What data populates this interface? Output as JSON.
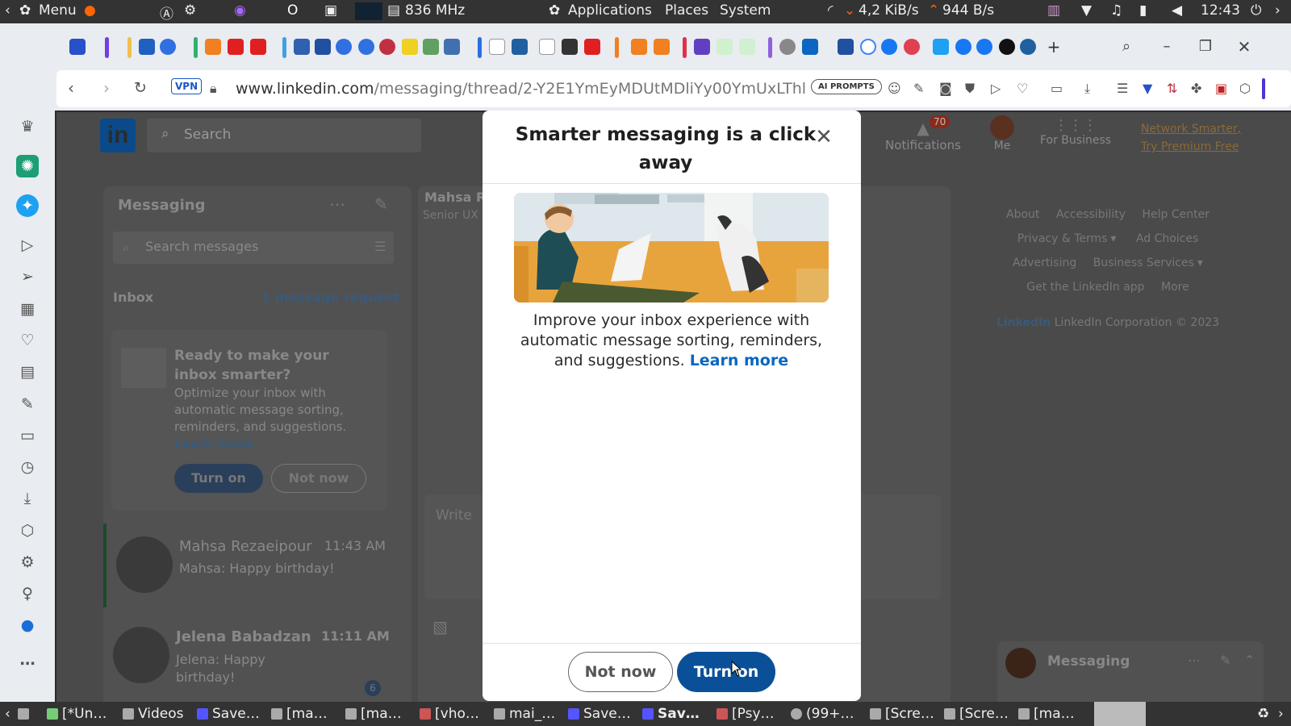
{
  "system_bar": {
    "menu_label": "Menu",
    "cpu_freq": "836 MHz",
    "applications_label": "Applications",
    "places_label": "Places",
    "system_label": "System",
    "net_down": "4,2 KiB/s",
    "net_up": "944 B/s",
    "clock": "12:43"
  },
  "browser": {
    "vpn_label": "VPN",
    "url_host": "www.linkedin.com",
    "url_path": "/messaging/thread/2-Y2E1YmEyMDUtMDliYy00YmUxLThl",
    "ai_prompts_label": "AI PROMPTS"
  },
  "linkedin": {
    "search_placeholder": "Search",
    "notifications_label": "Notifications",
    "notifications_count": "70",
    "me_label": "Me",
    "for_business_label": "For Business",
    "premium_line1": "Network Smarter,",
    "premium_line2": "Try Premium Free",
    "messaging_title": "Messaging",
    "search_messages_placeholder": "Search messages",
    "inbox_label": "Inbox",
    "message_request_label": "1 message request",
    "promo_title": "Ready to make your inbox smarter?",
    "promo_text": "Optimize your inbox with automatic message sorting, reminders, and suggestions.",
    "promo_learn_more": "Learn more.",
    "promo_turn_on": "Turn on",
    "promo_not_now": "Not now",
    "conversations": [
      {
        "name": "Mahsa Rezaeipour",
        "time": "11:43 AM",
        "snippet": "Mahsa: Happy birthday!"
      },
      {
        "name": "Jelena Babadzan",
        "time": "11:11 AM",
        "snippet": "Jelena: Happy birthday!",
        "unread": "6"
      }
    ],
    "thread_name": "Mahsa R",
    "thread_subtitle": "Senior UX",
    "write_placeholder": "Write",
    "footer_links": [
      "About",
      "Accessibility",
      "Help Center",
      "Privacy & Terms",
      "Ad Choices",
      "Advertising",
      "Business Services",
      "Get the LinkedIn app",
      "More"
    ],
    "footer_brand": "LinkedIn",
    "footer_copyright": "LinkedIn Corporation © 2023",
    "messaging_widget_label": "Messaging"
  },
  "modal": {
    "title": "Smarter messaging is a click away",
    "body_text": "Improve your inbox experience with automatic message sorting, reminders, and suggestions.",
    "learn_more": "Learn more",
    "not_now_label": "Not now",
    "turn_on_label": "Turn on"
  },
  "taskbar": {
    "items": [
      "[*Un…",
      "Videos",
      "Save…",
      "[ma…",
      "[ma…",
      "[vho…",
      "mai_…",
      "Save…",
      "Sav…",
      "[Psy…",
      "(99+…",
      "[Scre…",
      "[Scre…",
      "[ma…"
    ]
  }
}
